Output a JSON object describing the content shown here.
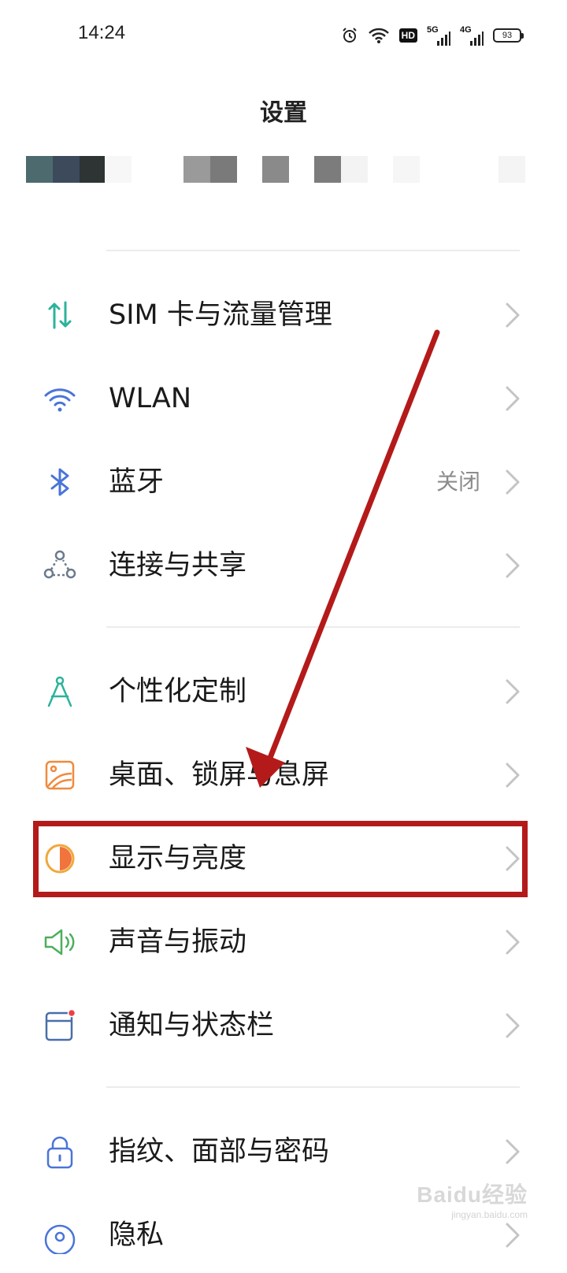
{
  "status_bar": {
    "time": "14:24",
    "hd_label": "HD",
    "net1_label": "5G",
    "net2_label": "4G",
    "battery": "93",
    "icons": [
      "alarm-icon",
      "wifi-icon",
      "hd-icon",
      "signal-5g-icon",
      "signal-4g-icon",
      "battery-icon"
    ]
  },
  "header": {
    "title": "设置"
  },
  "account_banner": {
    "blurred": true
  },
  "settings": {
    "items": [
      {
        "label": "SIM 卡与流量管理",
        "value": "",
        "icon": "sim-data-icon"
      },
      {
        "label": "WLAN",
        "value": "",
        "icon": "wifi-icon"
      },
      {
        "label": "蓝牙",
        "value": "关闭",
        "icon": "bluetooth-icon"
      },
      {
        "label": "连接与共享",
        "value": "",
        "icon": "connection-share-icon"
      },
      {
        "label": "个性化定制",
        "value": "",
        "icon": "compass-icon"
      },
      {
        "label": "桌面、锁屏与息屏",
        "value": "",
        "icon": "wallpaper-icon"
      },
      {
        "label": "显示与亮度",
        "value": "",
        "icon": "brightness-icon",
        "highlighted": true
      },
      {
        "label": "声音与振动",
        "value": "",
        "icon": "speaker-icon"
      },
      {
        "label": "通知与状态栏",
        "value": "",
        "icon": "notification-icon"
      },
      {
        "label": "指纹、面部与密码",
        "value": "",
        "icon": "lock-icon"
      },
      {
        "label": "隐私",
        "value": "",
        "icon": "privacy-icon"
      }
    ]
  },
  "annotation": {
    "color": "#b41a1a"
  },
  "watermark": {
    "main": "Baidu经验",
    "sub": "jingyan.baidu.com"
  },
  "colors": {
    "accent_teal": "#2bb39a",
    "accent_blue": "#4a74d9",
    "accent_orange": "#f08a3c",
    "chevron": "#c4c4c4"
  }
}
